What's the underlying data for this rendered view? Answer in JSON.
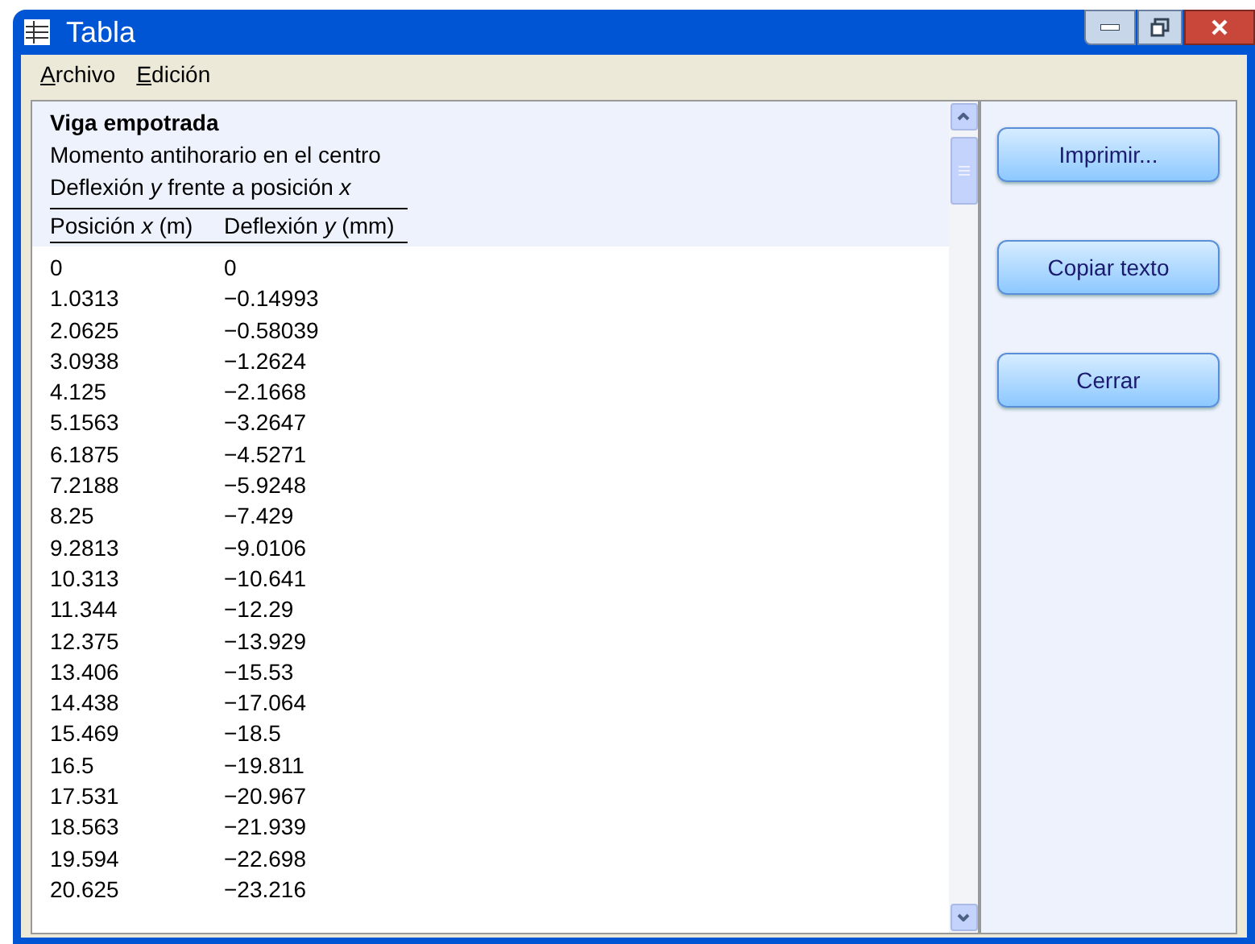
{
  "window": {
    "title": "Tabla"
  },
  "menu": [
    {
      "key": "A",
      "rest": "rchivo"
    },
    {
      "key": "E",
      "rest": "dición"
    }
  ],
  "table": {
    "title": "Viga empotrada",
    "subtitle": "Momento antihorario en el centro",
    "caption": "Deflexión *y* frente a posición *x*",
    "columns": [
      "Posición *x* (m)",
      "Deflexión *y* (mm)"
    ],
    "rows": [
      [
        "0",
        "0"
      ],
      [
        "1.0313",
        "−0.14993"
      ],
      [
        "2.0625",
        "−0.58039"
      ],
      [
        "3.0938",
        "−1.2624"
      ],
      [
        "4.125",
        "−2.1668"
      ],
      [
        "5.1563",
        "−3.2647"
      ],
      [
        "6.1875",
        "−4.5271"
      ],
      [
        "7.2188",
        "−5.9248"
      ],
      [
        "8.25",
        "−7.429"
      ],
      [
        "9.2813",
        "−9.0106"
      ],
      [
        "10.313",
        "−10.641"
      ],
      [
        "11.344",
        "−12.29"
      ],
      [
        "12.375",
        "−13.929"
      ],
      [
        "13.406",
        "−15.53"
      ],
      [
        "14.438",
        "−17.064"
      ],
      [
        "15.469",
        "−18.5"
      ],
      [
        "16.5",
        "−19.811"
      ],
      [
        "17.531",
        "−20.967"
      ],
      [
        "18.563",
        "−21.939"
      ],
      [
        "19.594",
        "−22.698"
      ],
      [
        "20.625",
        "−23.216"
      ]
    ]
  },
  "buttons": [
    "Imprimir...",
    "Copiar texto",
    "Cerrar"
  ]
}
